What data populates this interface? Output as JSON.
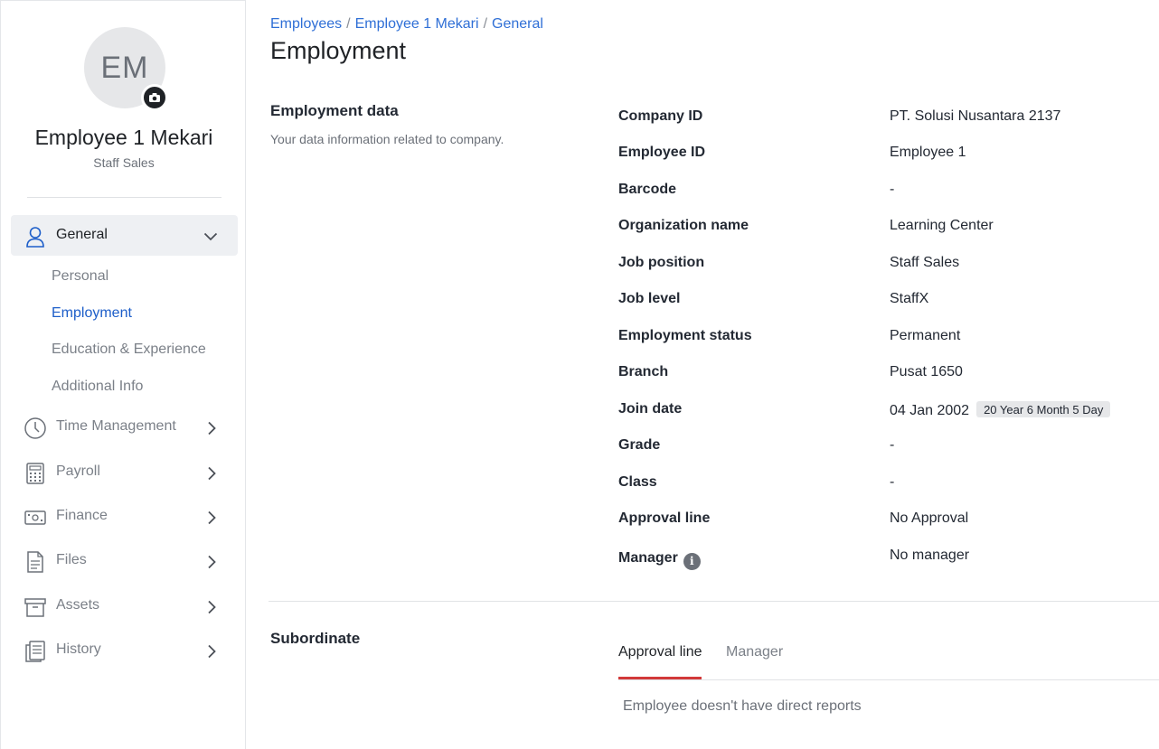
{
  "profile": {
    "initials": "EM",
    "name": "Employee 1 Mekari",
    "role": "Staff Sales"
  },
  "sidebar": {
    "general": {
      "label": "General",
      "subitems": [
        "Personal",
        "Employment",
        "Education & Experience",
        "Additional Info"
      ],
      "active": "Employment"
    },
    "items": [
      {
        "label": "Time Management",
        "icon": "clock-icon"
      },
      {
        "label": "Payroll",
        "icon": "calculator-icon"
      },
      {
        "label": "Finance",
        "icon": "money-icon"
      },
      {
        "label": "Files",
        "icon": "file-icon"
      },
      {
        "label": "Assets",
        "icon": "box-icon"
      },
      {
        "label": "History",
        "icon": "history-icon"
      }
    ]
  },
  "breadcrumb": [
    "Employees",
    "Employee 1 Mekari",
    "General"
  ],
  "page_title": "Employment",
  "employment_section": {
    "title": "Employment data",
    "description": "Your data information related to company."
  },
  "fields": [
    {
      "label": "Company ID",
      "value": "PT. Solusi Nusantara 2137"
    },
    {
      "label": "Employee ID",
      "value": "Employee 1"
    },
    {
      "label": "Barcode",
      "value": "-"
    },
    {
      "label": "Organization name",
      "value": "Learning Center"
    },
    {
      "label": "Job position",
      "value": "Staff Sales"
    },
    {
      "label": "Job level",
      "value": "StaffX"
    },
    {
      "label": "Employment status",
      "value": "Permanent"
    },
    {
      "label": "Branch",
      "value": "Pusat 1650"
    },
    {
      "label": "Join date",
      "value": "04 Jan 2002",
      "badge": "20 Year 6 Month 5 Day"
    },
    {
      "label": "Grade",
      "value": "-"
    },
    {
      "label": "Class",
      "value": "-"
    },
    {
      "label": "Approval line",
      "value": "No Approval"
    },
    {
      "label": "Manager",
      "value": "No manager",
      "info": "i"
    }
  ],
  "subordinate": {
    "title": "Subordinate",
    "tabs": [
      "Approval line",
      "Manager"
    ],
    "active_tab": "Approval line",
    "empty_message": "Employee doesn't have direct reports"
  },
  "colors": {
    "link": "#2f6fd6",
    "active_tab_underline": "#d23a3a",
    "active_nav": "#1d5ec9"
  }
}
